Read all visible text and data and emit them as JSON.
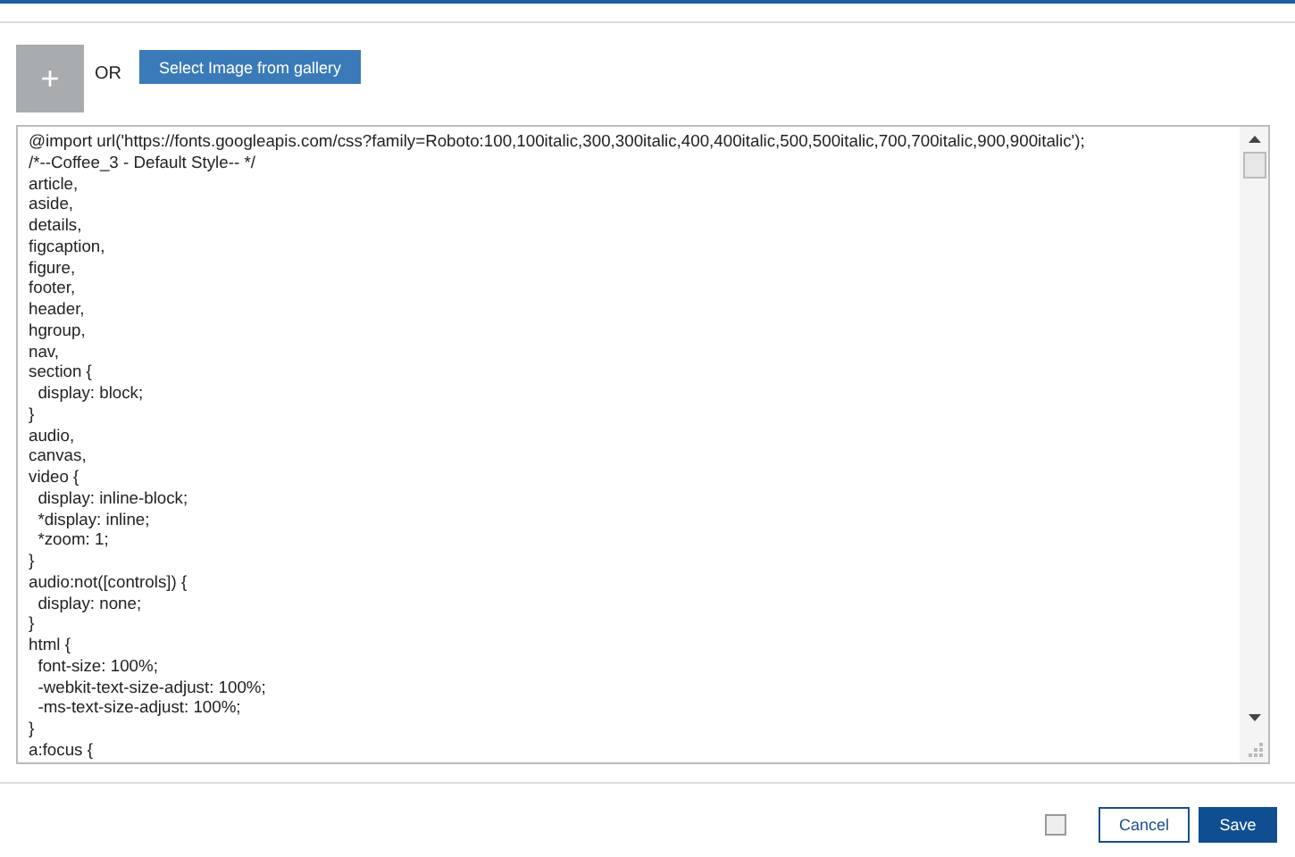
{
  "upload": {
    "plus": "+",
    "or": "OR",
    "gallery_button": "Select Image from gallery"
  },
  "css_editor": {
    "lines": [
      "@import url('https://fonts.googleapis.com/css?family=Roboto:100,100italic,300,300italic,400,400italic,500,500italic,700,700italic,900,900italic');",
      "/*--Coffee_3 - Default Style-- */",
      "article,",
      "aside,",
      "details,",
      "figcaption,",
      "figure,",
      "footer,",
      "header,",
      "hgroup,",
      "nav,",
      "section {",
      "  display: block;",
      "}",
      "audio,",
      "canvas,",
      "video {",
      "  display: inline-block;",
      "  *display: inline;",
      "  *zoom: 1;",
      "}",
      "audio:not([controls]) {",
      "  display: none;",
      "}",
      "html {",
      "  font-size: 100%;",
      "  -webkit-text-size-adjust: 100%;",
      "  -ms-text-size-adjust: 100%;",
      "}",
      "a:focus {"
    ]
  },
  "footer": {
    "checked": false,
    "cancel": "Cancel",
    "save": "Save"
  }
}
